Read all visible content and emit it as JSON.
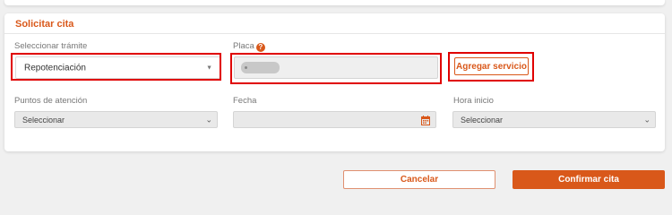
{
  "card": {
    "title": "Solicitar cita"
  },
  "tramite": {
    "label": "Seleccionar trámite",
    "value": "Repotenciación"
  },
  "placa": {
    "label": "Placa",
    "help_icon": "question-circle-icon"
  },
  "agregar_servicio": {
    "label": "Agregar servicio"
  },
  "puntos": {
    "label": "Puntos de atención",
    "value": "Seleccionar"
  },
  "fecha": {
    "label": "Fecha",
    "value": "",
    "icon": "calendar-icon"
  },
  "hora": {
    "label": "Hora inicio",
    "value": "Seleccionar"
  },
  "footer": {
    "cancel_label": "Cancelar",
    "confirm_label": "Confirmar cita"
  },
  "colors": {
    "accent": "#d9581a",
    "highlight": "#e00000",
    "background": "#f0f0f0"
  }
}
